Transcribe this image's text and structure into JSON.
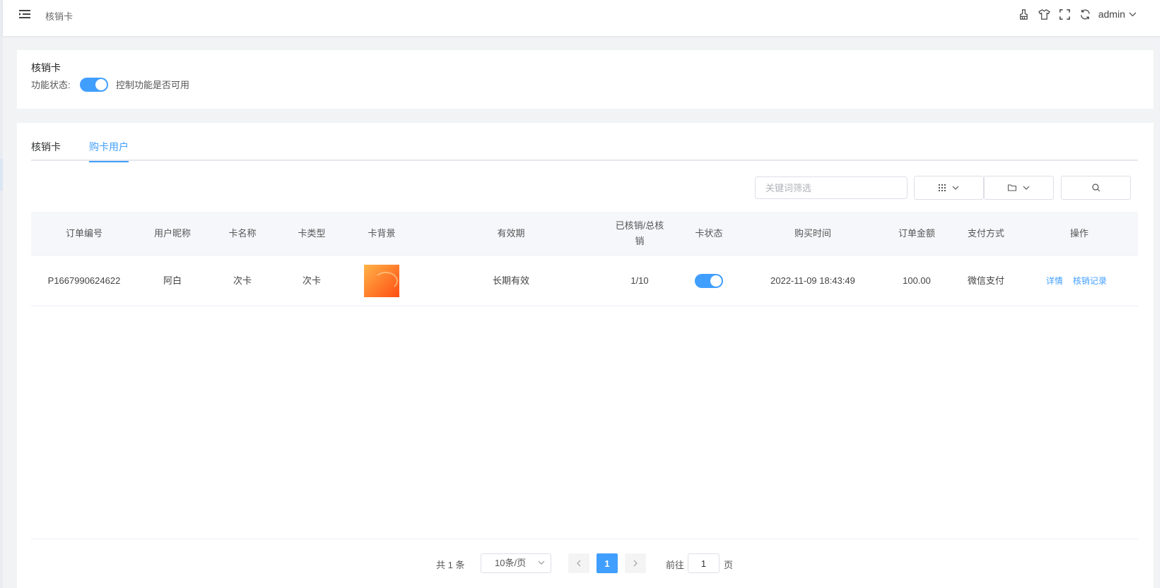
{
  "header": {
    "breadcrumb": "核销卡",
    "user": "admin",
    "icons": [
      "menu-fold-icon",
      "brush-icon",
      "shirt-icon",
      "fullscreen-icon",
      "refresh-icon",
      "chevron-down-icon"
    ]
  },
  "feature_card": {
    "title": "核销卡",
    "status_label": "功能状态:",
    "switch_on": true,
    "hint": "控制功能是否可用"
  },
  "tabs": [
    {
      "label": "核销卡",
      "active": false
    },
    {
      "label": "购卡用户",
      "active": true
    }
  ],
  "toolbar": {
    "search_placeholder": "关键词筛选",
    "icons": [
      "columns-icon",
      "folder-icon",
      "search-icon"
    ]
  },
  "table": {
    "columns": [
      "订单编号",
      "用户昵称",
      "卡名称",
      "卡类型",
      "卡背景",
      "有效期",
      "已核销/总核销",
      "卡状态",
      "购买时间",
      "订单金额",
      "支付方式",
      "操作"
    ],
    "rows": [
      {
        "order_no": "P1667990624622",
        "nickname": "阿白",
        "card_name": "次卡",
        "card_type": "次卡",
        "validity": "长期有效",
        "used_total": "1/10",
        "status_on": true,
        "buy_time": "2022-11-09 18:43:49",
        "amount": "100.00",
        "pay_method": "微信支付",
        "actions": [
          "详情",
          "核销记录"
        ]
      }
    ]
  },
  "pagination": {
    "total_text": "共 1 条",
    "page_size": "10条/页",
    "current_page": "1",
    "goto_label": "前往",
    "goto_value": "1",
    "page_unit": "页"
  },
  "colors": {
    "primary": "#409eff",
    "header_bg": "#f5f7fa",
    "page_bg": "#f2f3f5"
  }
}
